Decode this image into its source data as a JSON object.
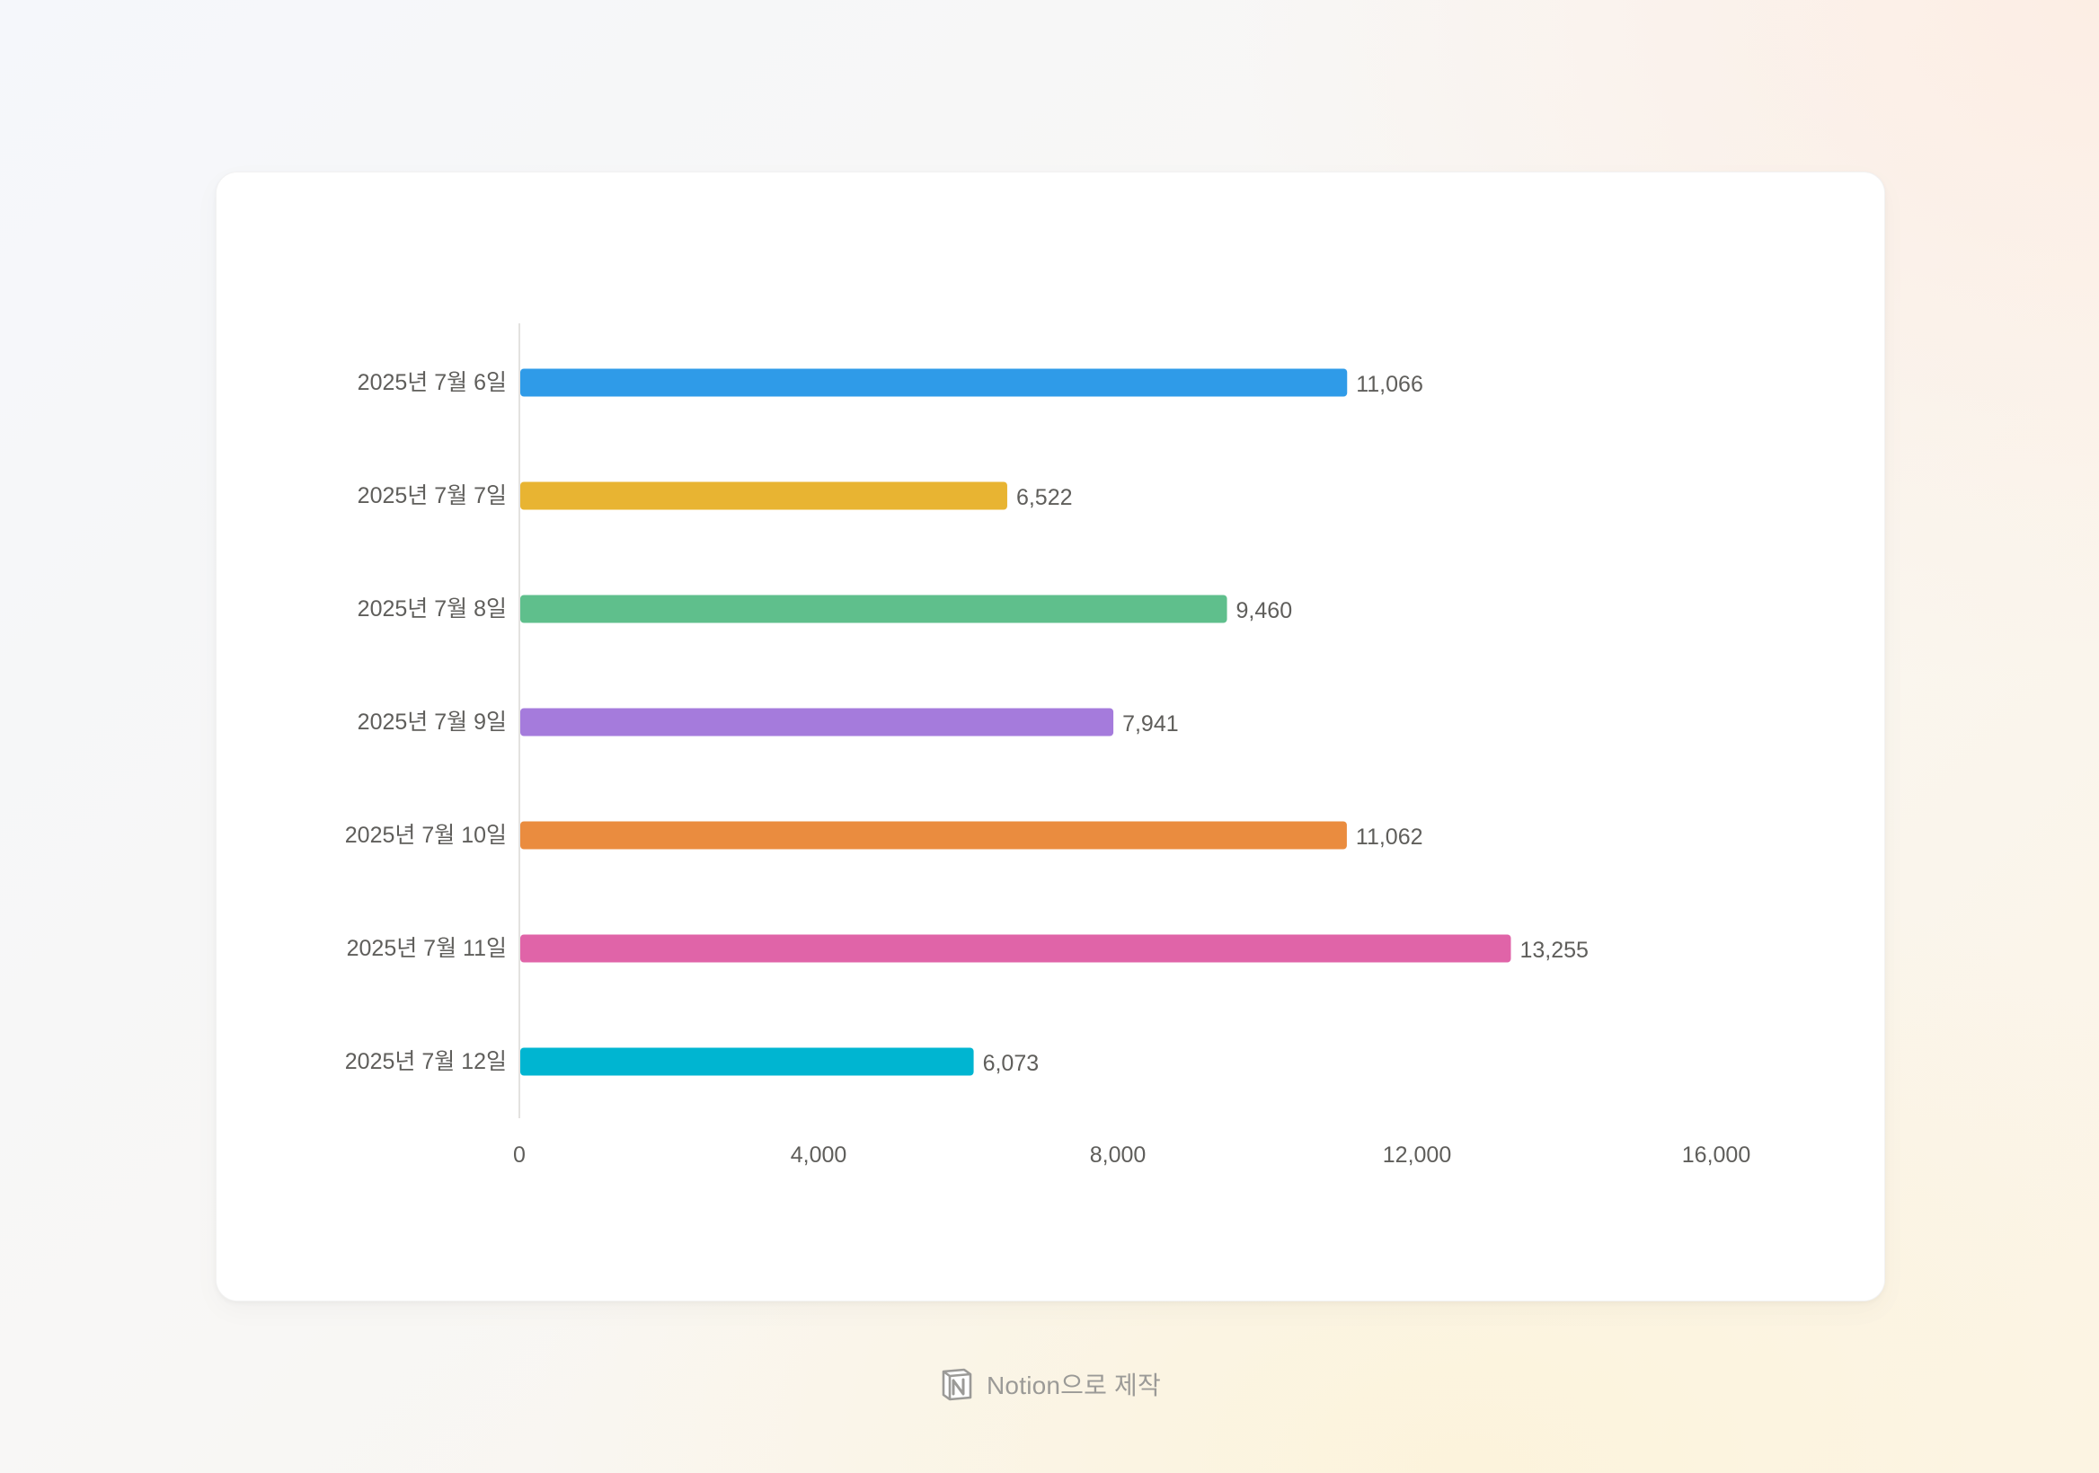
{
  "chart_data": {
    "type": "bar",
    "orientation": "horizontal",
    "categories": [
      "2025년 7월 6일",
      "2025년 7월 7일",
      "2025년 7월 8일",
      "2025년 7월 9일",
      "2025년 7월 10일",
      "2025년 7월 11일",
      "2025년 7월 12일"
    ],
    "values": [
      11066,
      6522,
      9460,
      7941,
      11062,
      13255,
      6073
    ],
    "value_labels": [
      "11,066",
      "6,522",
      "9,460",
      "7,941",
      "11,062",
      "13,255",
      "6,073"
    ],
    "colors": [
      "#2f9be8",
      "#e8b432",
      "#5fbf8c",
      "#a57bdc",
      "#ea8c3f",
      "#e064a8",
      "#00b5d1"
    ],
    "xlim": [
      0,
      16000
    ],
    "x_ticks": [
      0,
      4000,
      8000,
      12000,
      16000
    ],
    "x_tick_labels": [
      "0",
      "4,000",
      "8,000",
      "12,000",
      "16,000"
    ],
    "title": "",
    "xlabel": "",
    "ylabel": "",
    "grid": false,
    "legend": "none"
  },
  "footer": {
    "logo_icon": "notion-logo-icon",
    "text": "Notion으로 제작"
  }
}
